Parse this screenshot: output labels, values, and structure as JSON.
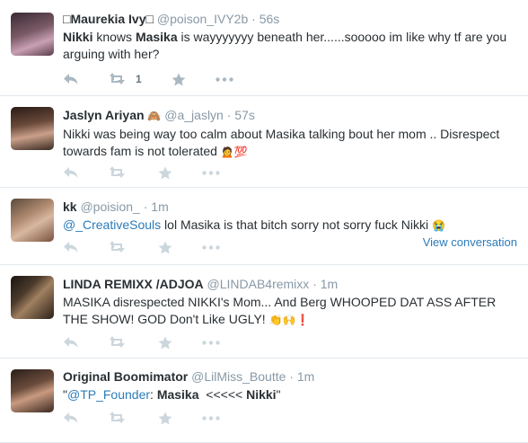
{
  "tweets": [
    {
      "fullname": "□Maurekia Ivy□",
      "username": "@poison_IVY2b",
      "separator": "·",
      "time": "56s",
      "text_parts": [
        "Nikki",
        " knows ",
        "Masika",
        " is wayyyyyyy beneath her......sooooo im like why tf are you arguing with her?"
      ],
      "retweet_count": "1"
    },
    {
      "fullname": "Jaslyn Ariyan",
      "name_emoji": "🙈",
      "username": "@a_jaslyn",
      "separator": "·",
      "time": "57s",
      "text": "Nikki was being way too calm about Masika talking bout her mom .. Disrespect towards fam is not tolerated",
      "text_emoji": "🙍💯"
    },
    {
      "fullname": "kk",
      "username": "@poision_",
      "separator": "·",
      "time": "1m",
      "mention": "@_CreativeSouls",
      "text": " lol Masika is that bitch sorry not sorry fuck Nikki",
      "text_emoji": "😭",
      "view_conversation": "View conversation"
    },
    {
      "fullname": "LINDA REMIXX /ADJOA",
      "username": "@LINDAB4remixx",
      "separator": "·",
      "time": "1m",
      "text": "MASIKA disrespected NIKKI's Mom... And Berg WHOOPED DAT ASS AFTER THE SHOW! GOD Don't Like UGLY!",
      "text_emoji": "👏🙌❗"
    },
    {
      "fullname": "Original Boomimator",
      "username": "@LilMiss_Boutte",
      "separator": "·",
      "time": "1m",
      "quote_open": "\"",
      "mention": "@TP_Founder",
      "text_parts": [
        ": ",
        "Masika",
        "  <<<<< ",
        "Nikki",
        "\""
      ]
    }
  ],
  "icons": {
    "reply": "reply-icon",
    "retweet": "retweet-icon",
    "favorite": "star-icon",
    "more": "more-dots-icon"
  },
  "colors": {
    "text": "#292f33",
    "secondary": "#8899a6",
    "link": "#2b7bb9",
    "action_icon": "#aab8c2",
    "divider": "#e1e8ed"
  }
}
